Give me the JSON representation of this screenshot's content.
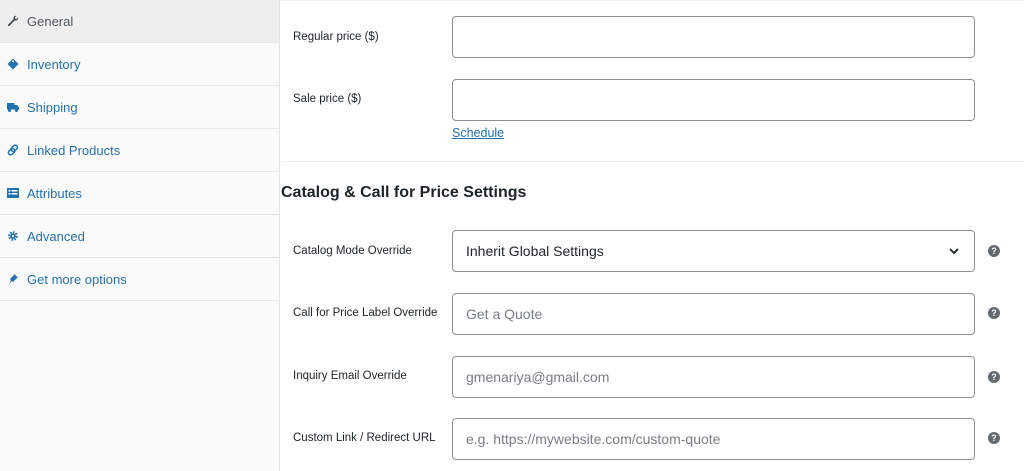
{
  "sidebar": {
    "items": [
      {
        "label": "General",
        "icon": "wrench-icon",
        "active": true
      },
      {
        "label": "Inventory",
        "icon": "tag-icon"
      },
      {
        "label": "Shipping",
        "icon": "truck-icon"
      },
      {
        "label": "Linked Products",
        "icon": "link-icon"
      },
      {
        "label": "Attributes",
        "icon": "list-table-icon"
      },
      {
        "label": "Advanced",
        "icon": "gear-icon"
      },
      {
        "label": "Get more options",
        "icon": "plugin-icon"
      }
    ]
  },
  "pricing": {
    "regular_price_label": "Regular price ($)",
    "regular_price_value": "",
    "sale_price_label": "Sale price ($)",
    "sale_price_value": "",
    "schedule_link": "Schedule"
  },
  "catalog": {
    "heading": "Catalog & Call for Price Settings",
    "mode_label": "Catalog Mode Override",
    "mode_value": "Inherit Global Settings",
    "cfp_label": "Call for Price Label Override",
    "cfp_placeholder": "Get a Quote",
    "email_label": "Inquiry Email Override",
    "email_placeholder": "gmenariya@gmail.com",
    "url_label": "Custom Link / Redirect URL",
    "url_placeholder": "e.g. https://mywebsite.com/custom-quote",
    "help_glyph": "?"
  },
  "colors": {
    "link": "#2271b1",
    "help_bg": "#646970",
    "sidebar_bg": "#fafafa",
    "active_tab_bg": "#eeeeee"
  }
}
